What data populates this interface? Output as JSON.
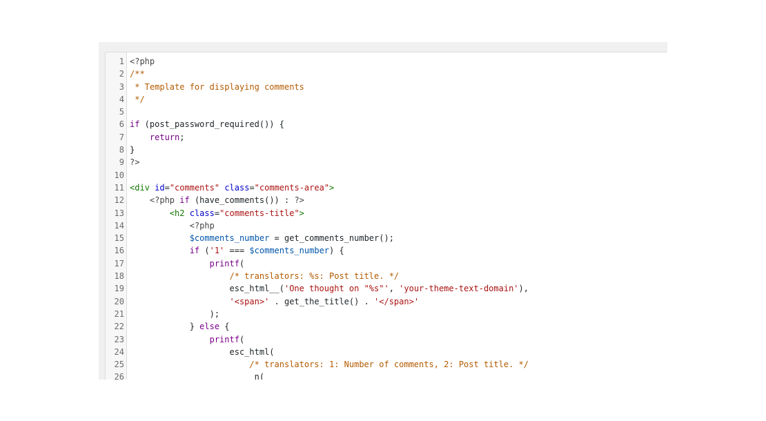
{
  "editor": {
    "lines": [
      {
        "n": "1",
        "tokens": [
          {
            "t": "<?php",
            "c": "php"
          }
        ]
      },
      {
        "n": "2",
        "tokens": [
          {
            "t": "/**",
            "c": "com"
          }
        ]
      },
      {
        "n": "3",
        "tokens": [
          {
            "t": " * Template for displaying comments",
            "c": "com"
          }
        ]
      },
      {
        "n": "4",
        "tokens": [
          {
            "t": " */",
            "c": "com"
          }
        ]
      },
      {
        "n": "5",
        "tokens": []
      },
      {
        "n": "6",
        "tokens": [
          {
            "t": "if",
            "c": "kw"
          },
          {
            "t": " (post_password_required()) {",
            "c": ""
          }
        ]
      },
      {
        "n": "7",
        "tokens": [
          {
            "t": "    ",
            "c": ""
          },
          {
            "t": "return",
            "c": "kw"
          },
          {
            "t": ";",
            "c": ""
          }
        ]
      },
      {
        "n": "8",
        "tokens": [
          {
            "t": "}",
            "c": ""
          }
        ]
      },
      {
        "n": "9",
        "tokens": [
          {
            "t": "?>",
            "c": "php"
          }
        ]
      },
      {
        "n": "10",
        "tokens": []
      },
      {
        "n": "11",
        "tokens": [
          {
            "t": "<div",
            "c": "tag"
          },
          {
            "t": " ",
            "c": ""
          },
          {
            "t": "id",
            "c": "attr"
          },
          {
            "t": "=",
            "c": ""
          },
          {
            "t": "\"comments\"",
            "c": "str"
          },
          {
            "t": " ",
            "c": ""
          },
          {
            "t": "class",
            "c": "attr"
          },
          {
            "t": "=",
            "c": ""
          },
          {
            "t": "\"comments-area\"",
            "c": "str"
          },
          {
            "t": ">",
            "c": "tag"
          }
        ]
      },
      {
        "n": "12",
        "tokens": [
          {
            "t": "    ",
            "c": ""
          },
          {
            "t": "<?php",
            "c": "php"
          },
          {
            "t": " ",
            "c": ""
          },
          {
            "t": "if",
            "c": "kw"
          },
          {
            "t": " (have_comments()) : ",
            "c": ""
          },
          {
            "t": "?>",
            "c": "php"
          }
        ]
      },
      {
        "n": "13",
        "tokens": [
          {
            "t": "        ",
            "c": ""
          },
          {
            "t": "<h2",
            "c": "tag"
          },
          {
            "t": " ",
            "c": ""
          },
          {
            "t": "class",
            "c": "attr"
          },
          {
            "t": "=",
            "c": ""
          },
          {
            "t": "\"comments-title\"",
            "c": "str"
          },
          {
            "t": ">",
            "c": "tag"
          }
        ]
      },
      {
        "n": "14",
        "tokens": [
          {
            "t": "            ",
            "c": ""
          },
          {
            "t": "<?php",
            "c": "php"
          }
        ]
      },
      {
        "n": "15",
        "tokens": [
          {
            "t": "            ",
            "c": ""
          },
          {
            "t": "$comments_number",
            "c": "var"
          },
          {
            "t": " = get_comments_number();",
            "c": ""
          }
        ]
      },
      {
        "n": "16",
        "tokens": [
          {
            "t": "            ",
            "c": ""
          },
          {
            "t": "if",
            "c": "kw"
          },
          {
            "t": " (",
            "c": ""
          },
          {
            "t": "'1'",
            "c": "str"
          },
          {
            "t": " === ",
            "c": ""
          },
          {
            "t": "$comments_number",
            "c": "var"
          },
          {
            "t": ") {",
            "c": ""
          }
        ]
      },
      {
        "n": "17",
        "tokens": [
          {
            "t": "                ",
            "c": ""
          },
          {
            "t": "printf",
            "c": "kw"
          },
          {
            "t": "(",
            "c": ""
          }
        ]
      },
      {
        "n": "18",
        "tokens": [
          {
            "t": "                    ",
            "c": ""
          },
          {
            "t": "/* translators: %s: Post title. */",
            "c": "com"
          }
        ]
      },
      {
        "n": "19",
        "tokens": [
          {
            "t": "                    esc_html__(",
            "c": ""
          },
          {
            "t": "'One thought on \"%s\"'",
            "c": "str"
          },
          {
            "t": ", ",
            "c": ""
          },
          {
            "t": "'your-theme-text-domain'",
            "c": "str"
          },
          {
            "t": "),",
            "c": ""
          }
        ]
      },
      {
        "n": "20",
        "tokens": [
          {
            "t": "                    ",
            "c": ""
          },
          {
            "t": "'<span>'",
            "c": "str"
          },
          {
            "t": " . get_the_title() . ",
            "c": ""
          },
          {
            "t": "'</span>'",
            "c": "str"
          }
        ]
      },
      {
        "n": "21",
        "tokens": [
          {
            "t": "                );",
            "c": ""
          }
        ]
      },
      {
        "n": "22",
        "tokens": [
          {
            "t": "            } ",
            "c": ""
          },
          {
            "t": "else",
            "c": "kw"
          },
          {
            "t": " {",
            "c": ""
          }
        ]
      },
      {
        "n": "23",
        "tokens": [
          {
            "t": "                ",
            "c": ""
          },
          {
            "t": "printf",
            "c": "kw"
          },
          {
            "t": "(",
            "c": ""
          }
        ]
      },
      {
        "n": "24",
        "tokens": [
          {
            "t": "                    esc_html(",
            "c": ""
          }
        ]
      },
      {
        "n": "25",
        "tokens": [
          {
            "t": "                        ",
            "c": ""
          },
          {
            "t": "/* translators: 1: Number of comments, 2: Post title. */",
            "c": "com"
          }
        ]
      },
      {
        "n": "26",
        "tokens": [
          {
            "t": "                        _n(",
            "c": ""
          }
        ]
      }
    ]
  }
}
